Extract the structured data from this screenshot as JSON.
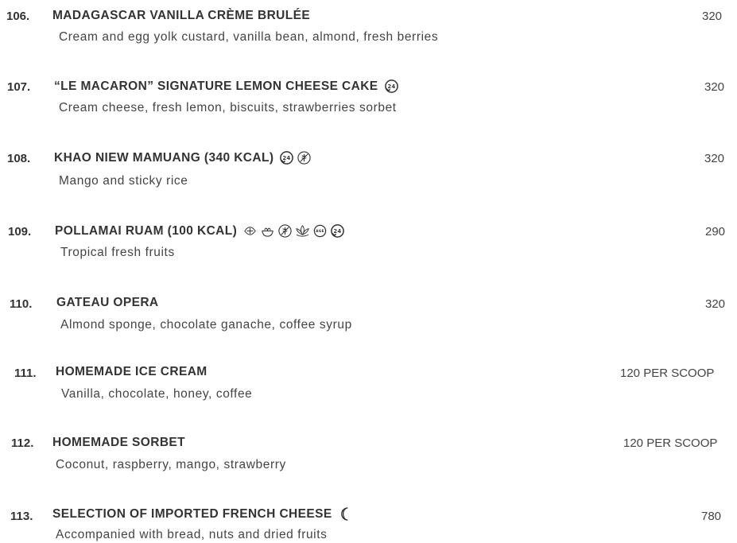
{
  "menu": {
    "items": [
      {
        "number": "106.",
        "name": "MADAGASCAR VANILLA CRÈME BRULÉE",
        "description": "Cream and egg yolk custard, vanilla bean, almond, fresh berries",
        "price": "320",
        "icons": []
      },
      {
        "number": "107.",
        "name": "“LE MACARON” SIGNATURE LEMON CHEESE CAKE",
        "description": "Cream cheese, fresh lemon, biscuits, strawberries sorbet",
        "price": "320",
        "icons": [
          "24-hour-phone-icon"
        ]
      },
      {
        "number": "108.",
        "name": "KHAO NIEW MAMUANG (340 KCAL)",
        "description": "Mango and sticky rice",
        "price": "320",
        "icons": [
          "24-hour-phone-icon",
          "gluten-free-icon"
        ]
      },
      {
        "number": "109.",
        "name": "POLLAMAI RUAM (100 KCAL)",
        "description": "Tropical fresh fruits",
        "price": "290",
        "icons": [
          "vegan-leaf-icon",
          "vegetarian-bowl-icon",
          "gluten-free-icon",
          "lotus-wellness-icon",
          "age-icon",
          "24-hour-phone-icon"
        ]
      },
      {
        "number": "110.",
        "name": "GATEAU OPERA",
        "description": "Almond sponge, chocolate ganache, coffee syrup",
        "price": "320",
        "icons": []
      },
      {
        "number": "111.",
        "name": "HOMEMADE ICE CREAM",
        "description": "Vanilla, chocolate, honey, coffee",
        "price": "120  PER SCOOP",
        "icons": []
      },
      {
        "number": "112.",
        "name": "HOMEMADE SORBET",
        "description": "Coconut, raspberry, mango, strawberry",
        "price": "120  PER SCOOP",
        "icons": []
      },
      {
        "number": "113.",
        "name": "SELECTION OF IMPORTED FRENCH CHEESE",
        "description": "Accompanied with bread, nuts and dried fruits",
        "price": "780",
        "icons": [
          "crescent-moon-icon"
        ]
      }
    ]
  }
}
